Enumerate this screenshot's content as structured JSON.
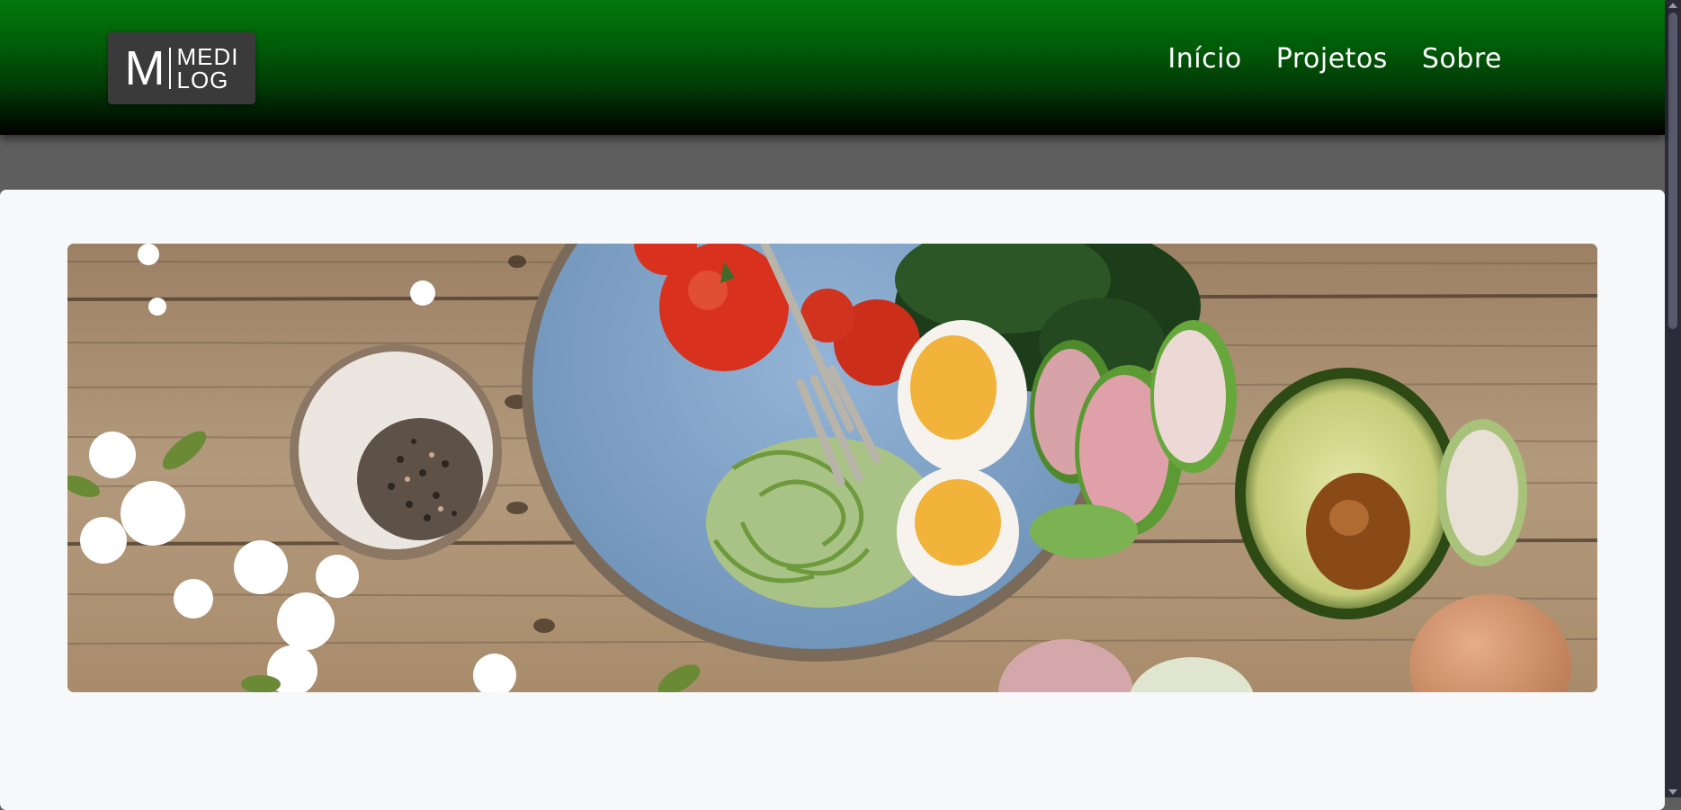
{
  "header": {
    "logo": {
      "letter": "M",
      "line1": "MEDI",
      "line2": "LOG"
    },
    "nav": [
      {
        "label": "Início"
      },
      {
        "label": "Projetos"
      },
      {
        "label": "Sobre"
      }
    ]
  },
  "colors": {
    "header_top": "#027a0c",
    "header_bottom": "#000000",
    "page_background": "#5e5e5e",
    "card_background": "#f7f8fa"
  },
  "icons": [
    "scroll-up-arrow-icon",
    "scroll-down-arrow-icon"
  ]
}
